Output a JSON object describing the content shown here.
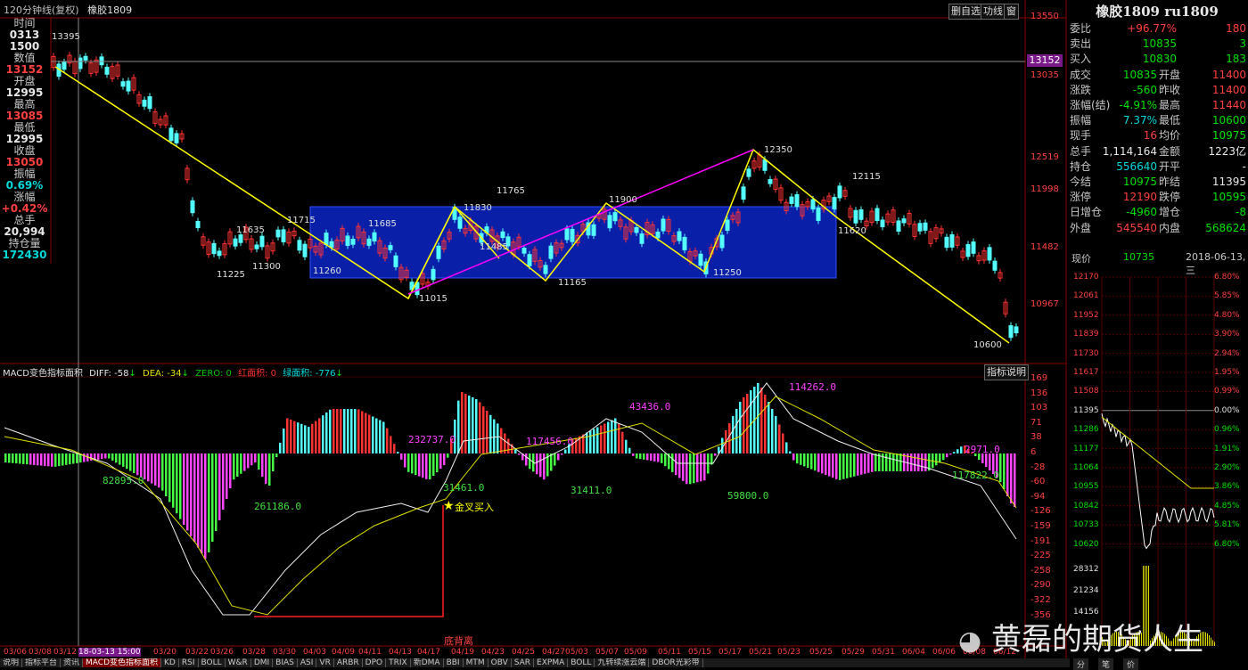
{
  "header": {
    "chart_title": "120分钟线(复权)",
    "symbol": "橡胶1809",
    "buttons": [
      "删自选",
      "功线",
      "窗"
    ]
  },
  "left_info": [
    {
      "label": "时间",
      "value": "0313",
      "color": "#e8e8e8"
    },
    {
      "label": "",
      "value": "1500",
      "color": "#e8e8e8"
    },
    {
      "label": "数值",
      "value": "13152",
      "color": "#ff4040"
    },
    {
      "label": "开盘",
      "value": "12995",
      "color": "#e8e8e8"
    },
    {
      "label": "最高",
      "value": "13085",
      "color": "#ff4040"
    },
    {
      "label": "最低",
      "value": "12995",
      "color": "#e8e8e8"
    },
    {
      "label": "收盘",
      "value": "13050",
      "color": "#ff4040"
    },
    {
      "label": "振幅",
      "value": "0.69%",
      "color": "#00d8d8"
    },
    {
      "label": "涨幅",
      "value": "+0.42%",
      "color": "#ff4040"
    },
    {
      "label": "总手",
      "value": "20,994",
      "color": "#e8e8e8"
    },
    {
      "label": "持仓量",
      "value": "172430",
      "color": "#00d8d8"
    }
  ],
  "price_axis": [
    "13550",
    "13035",
    "12519",
    "11998",
    "11482",
    "10967"
  ],
  "crosshair_price": "13152",
  "price_labels": [
    {
      "text": "13395",
      "color": "#e0e0e0"
    },
    {
      "text": "11715",
      "color": "#e0e0e0"
    },
    {
      "text": "11635",
      "color": "#e0e0e0"
    },
    {
      "text": "11300",
      "color": "#e0e0e0"
    },
    {
      "text": "11225",
      "color": "#e0e0e0"
    },
    {
      "text": "11260",
      "color": "#e0e0e0"
    },
    {
      "text": "11685",
      "color": "#e0e0e0"
    },
    {
      "text": "11015",
      "color": "#e0e0e0"
    },
    {
      "text": "11830",
      "color": "#e0e0e0"
    },
    {
      "text": "11765",
      "color": "#e0e0e0"
    },
    {
      "text": "11485",
      "color": "#e0e0e0"
    },
    {
      "text": "11165",
      "color": "#e0e0e0"
    },
    {
      "text": "11900",
      "color": "#e0e0e0"
    },
    {
      "text": "11250",
      "color": "#e0e0e0"
    },
    {
      "text": "12350",
      "color": "#e0e0e0"
    },
    {
      "text": "12115",
      "color": "#e0e0e0"
    },
    {
      "text": "11620",
      "color": "#e0e0e0"
    },
    {
      "text": "10600",
      "color": "#e0e0e0"
    }
  ],
  "macd": {
    "title": "MACD变色指标面积",
    "diff": "DIFF: -58",
    "dea": "DEA: -34",
    "zero": "ZERO: 0",
    "red_area": "红面积: 0",
    "green_area": "绿面积: -776",
    "help_button": "指标说明",
    "axis": [
      "169",
      "136",
      "103",
      "71",
      "38",
      "6",
      "-28",
      "-60",
      "-94",
      "-126",
      "-159",
      "-191",
      "-225",
      "-258",
      "-290",
      "-322",
      "-356"
    ],
    "annotations": [
      {
        "text": "82895.0",
        "color": "#40e040"
      },
      {
        "text": "261186.0",
        "color": "#40e040"
      },
      {
        "text": "232737.0",
        "color": "#ff40ff"
      },
      {
        "text": "31461.0",
        "color": "#40e040"
      },
      {
        "text": "117456.0",
        "color": "#ff40ff"
      },
      {
        "text": "31411.0",
        "color": "#40e040"
      },
      {
        "text": "43436.0",
        "color": "#ff40ff"
      },
      {
        "text": "59800.0",
        "color": "#40e040"
      },
      {
        "text": "114262.0",
        "color": "#ff40ff"
      },
      {
        "text": "2971.0",
        "color": "#ff40ff"
      },
      {
        "text": "117822.0",
        "color": "#40e040"
      },
      {
        "text": "金叉买入",
        "color": "#ffff00"
      },
      {
        "text": "底背离",
        "color": "#ff4040"
      }
    ]
  },
  "date_axis": [
    "03/06",
    "03/08",
    "03/12",
    "18-03-13 15:00",
    "03/20",
    "03/22",
    "03/26",
    "03/28",
    "03/30",
    "04/03",
    "04/09",
    "04/11",
    "04/13",
    "04/17",
    "04/19",
    "04/23",
    "04/25",
    "04/27",
    "05/03",
    "05/07",
    "05/09",
    "05/11",
    "05/15",
    "05/17",
    "05/21",
    "05/23",
    "05/25",
    "05/29",
    "05/31",
    "06/04",
    "06/06",
    "06/08",
    "06/12"
  ],
  "bottom_tabs": [
    "说明",
    "指标平台",
    "资讯",
    "MACD变色指标面积",
    "KD",
    "RSI",
    "BOLL",
    "W&R",
    "DMI",
    "BIAS",
    "ASI",
    "VR",
    "ARBR",
    "DPO",
    "TRIX",
    "新DMA",
    "BBI",
    "MTM",
    "OBV",
    "SAR",
    "EXPMA",
    "BOLL",
    "九转续涨云端",
    "DBOR光彩带"
  ],
  "quote_panel": {
    "title": "橡胶1809 ru1809",
    "rows": [
      [
        {
          "t": "委比",
          "c": "lbl"
        },
        {
          "t": "+96.77%",
          "c": "red"
        },
        {
          "t": "180",
          "c": "red"
        }
      ],
      [
        {
          "t": "卖出",
          "c": "lbl"
        },
        {
          "t": "10835",
          "c": "grn"
        },
        {
          "t": "3",
          "c": "grn"
        }
      ],
      [
        {
          "t": "买入",
          "c": "lbl"
        },
        {
          "t": "10830",
          "c": "grn"
        },
        {
          "t": "183",
          "c": "grn"
        }
      ],
      [
        {
          "t": "成交",
          "c": "lbl"
        },
        {
          "t": "10835",
          "c": "grn"
        },
        {
          "t": "开盘",
          "c": "lbl"
        },
        {
          "t": "11400",
          "c": "red"
        }
      ],
      [
        {
          "t": "涨跌",
          "c": "lbl"
        },
        {
          "t": "-560",
          "c": "grn"
        },
        {
          "t": "昨收",
          "c": "lbl"
        },
        {
          "t": "11400",
          "c": "red"
        }
      ],
      [
        {
          "t": "涨幅(结)",
          "c": "lbl"
        },
        {
          "t": "-4.91%",
          "c": "grn"
        },
        {
          "t": "最高",
          "c": "lbl"
        },
        {
          "t": "11440",
          "c": "red"
        }
      ],
      [
        {
          "t": "振幅",
          "c": "lbl"
        },
        {
          "t": "7.37%",
          "c": "cyan"
        },
        {
          "t": "最低",
          "c": "lbl"
        },
        {
          "t": "10600",
          "c": "grn"
        }
      ],
      [
        {
          "t": "现手",
          "c": "lbl"
        },
        {
          "t": "16",
          "c": "red"
        },
        {
          "t": "均价",
          "c": "lbl"
        },
        {
          "t": "10975",
          "c": "grn"
        }
      ],
      [
        {
          "t": "总手",
          "c": "lbl"
        },
        {
          "t": "1,114,164",
          "c": "wht"
        },
        {
          "t": "金额",
          "c": "lbl"
        },
        {
          "t": "1223亿",
          "c": "wht"
        }
      ],
      [
        {
          "t": "持仓",
          "c": "lbl"
        },
        {
          "t": "556640",
          "c": "cyan"
        },
        {
          "t": "开平",
          "c": "lbl"
        },
        {
          "t": "-",
          "c": "wht"
        }
      ],
      [
        {
          "t": "今结",
          "c": "lbl"
        },
        {
          "t": "10975",
          "c": "grn"
        },
        {
          "t": "昨结",
          "c": "lbl"
        },
        {
          "t": "11395",
          "c": "wht"
        }
      ],
      [
        {
          "t": "涨停",
          "c": "lbl"
        },
        {
          "t": "12190",
          "c": "red"
        },
        {
          "t": "跌停",
          "c": "lbl"
        },
        {
          "t": "10595",
          "c": "grn"
        }
      ],
      [
        {
          "t": "日增仓",
          "c": "lbl"
        },
        {
          "t": "-4960",
          "c": "grn"
        },
        {
          "t": "增仓",
          "c": "lbl"
        },
        {
          "t": "-8",
          "c": "grn"
        }
      ],
      [
        {
          "t": "外盘",
          "c": "lbl"
        },
        {
          "t": "545540",
          "c": "red"
        },
        {
          "t": "内盘",
          "c": "lbl"
        },
        {
          "t": "568624",
          "c": "grn"
        }
      ]
    ],
    "current_label": "现价",
    "current_price": "10735",
    "date": "2018-06-13,三"
  },
  "intraday": {
    "left_axis": [
      "12170",
      "12061",
      "11952",
      "11839",
      "11730",
      "11617",
      "11508",
      "11395",
      "11286",
      "11177",
      "11064",
      "10955",
      "10842",
      "10733",
      "10620",
      "28312",
      "21234",
      "14156"
    ],
    "right_axis": [
      "6.80%",
      "5.85%",
      "4.80%",
      "3.90%",
      "2.94%",
      "1.95%",
      "0.99%",
      "0.00%",
      "0.96%",
      "1.91%",
      "2.90%",
      "3.86%",
      "4.85%",
      "5.81%",
      "6.80%"
    ]
  },
  "watermark": "黄磊的期货人生",
  "bottom_right_tabs": [
    "分",
    "笔",
    "价"
  ],
  "colors": {
    "up": "#ff3232",
    "down": "#54ffff",
    "box": "#0a1fa8",
    "yellow": "#ffff00",
    "magenta": "#ff00ff"
  }
}
